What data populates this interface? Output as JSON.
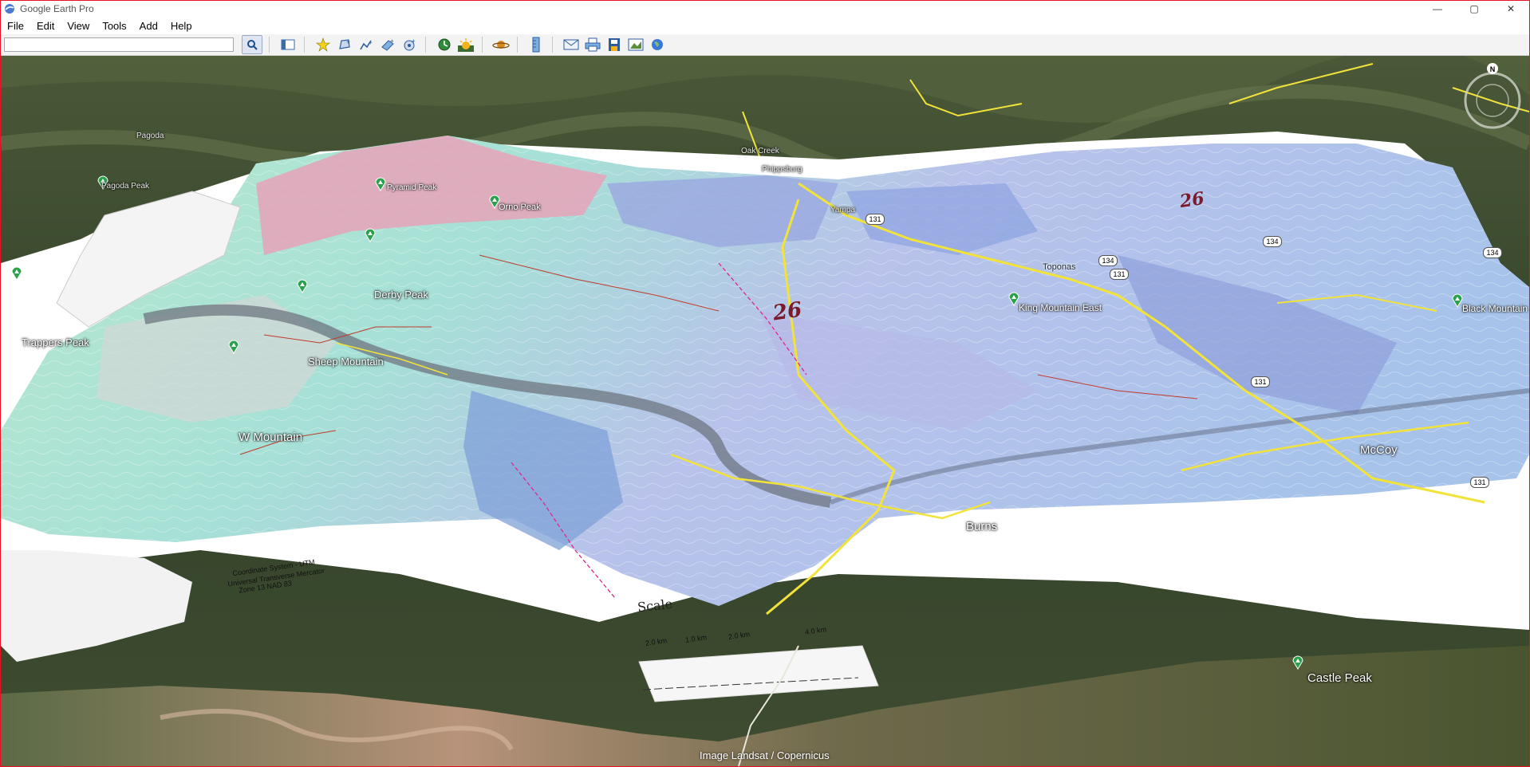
{
  "window": {
    "title": "Google Earth Pro",
    "controls": {
      "minimize": "—",
      "maximize": "▢",
      "close": "✕"
    }
  },
  "menu": {
    "items": [
      "File",
      "Edit",
      "View",
      "Tools",
      "Add",
      "Help"
    ]
  },
  "toolbar": {
    "search_value": "",
    "buttons": [
      "search-icon",
      "sidebar-toggle-icon",
      "placemark-icon",
      "polygon-icon",
      "path-icon",
      "image-overlay-icon",
      "tour-icon",
      "historical-imagery-icon",
      "sunlight-icon",
      "planets-icon",
      "ruler-icon",
      "email-icon",
      "print-icon",
      "save-image-icon",
      "view-in-maps-icon",
      "earth-icon"
    ]
  },
  "map": {
    "places": {
      "trappers_peak": "Trappers Peak",
      "sheep_mountain": "Sheep Mountain",
      "w_mountain": "W Mountain",
      "derby_peak": "Derby Peak",
      "orno_peak": "Orno Peak",
      "pyramid_peak": "Pyramid Peak",
      "pagoda_peak": "Pagoda Peak",
      "pagoda": "Pagoda",
      "king_mountain_east": "King Mountain East",
      "black_mountain": "Black Mountain",
      "toponas": "Toponas",
      "mccoy": "McCoy",
      "burns": "Burns",
      "castle_peak": "Castle Peak",
      "yampa": "Yampa",
      "phippsburg": "Phippsburg",
      "oak_creek": "Oak Creek"
    },
    "routes": [
      "131",
      "131",
      "131",
      "134",
      "134",
      "134",
      "131"
    ],
    "map_numbers": [
      "26",
      "26"
    ],
    "scale": {
      "title": "Scale",
      "ticks": [
        "2.0 km",
        "1.0 km",
        "2.0 km",
        "4.0 km"
      ]
    },
    "legend_lines": [
      "Coordinate System - UTM",
      "Universal Transverse Mercator",
      "Zone 13 NAD 83"
    ],
    "attribution": "Image Landsat / Copernicus",
    "compass_north": "N",
    "colors": {
      "terrain_dark": "#3c4a30",
      "overlay_blue": "#a9b8e8",
      "overlay_teal": "#9fe0cf",
      "road_yellow": "#f2e33a"
    }
  }
}
